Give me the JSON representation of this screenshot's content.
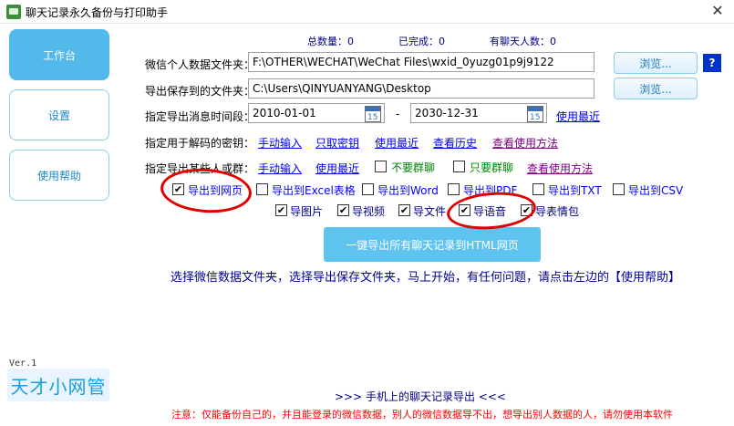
{
  "window": {
    "title": "聊天记录永久备份与打印助手",
    "close_glyph": "✕"
  },
  "nav": {
    "items": [
      {
        "label": "工作台",
        "active": true
      },
      {
        "label": "设置",
        "active": false
      },
      {
        "label": "使用帮助",
        "active": false
      }
    ],
    "version": "Ver.1",
    "logo": "天才小网管"
  },
  "stats": {
    "total": "总数量：0",
    "done": "已完成：0",
    "chat_people": "有聊天人数：0"
  },
  "form": {
    "wechat_folder_label": "微信个人数据文件夹：",
    "wechat_folder_value": "F:\\OTHER\\WECHAT\\WeChat Files\\wxid_0yuzg01p9j9122",
    "export_folder_label": "导出保存到的文件夹：",
    "export_folder_value": "C:\\Users\\QINYUANYANG\\Desktop",
    "browse_label": "浏览...",
    "help_q": "?",
    "time_label": "指定导出消息时间段：",
    "date_start": "2010-01-01",
    "date_sep": "-",
    "date_end": "2030-12-31",
    "cal_num": "15",
    "use_recent": "使用最近",
    "key_label": "指定用于解码的密钥：",
    "key_links": {
      "manual": "手动输入",
      "fetch": "只取密钥",
      "recent": "使用最近",
      "history": "查看历史",
      "method": "查看使用方法"
    },
    "people_label": "指定导出某些人或群：",
    "people_links": {
      "manual": "手动输入",
      "recent": "使用最近",
      "method": "查看使用方法"
    },
    "no_groups": "不要群聊",
    "only_groups": "只要群聊"
  },
  "export_formats": [
    {
      "label": "导出到网页",
      "checked": true
    },
    {
      "label": "导出到Excel表格",
      "checked": false
    },
    {
      "label": "导出到Word",
      "checked": false
    },
    {
      "label": "导出到PDF",
      "checked": false
    },
    {
      "label": "导出到TXT",
      "checked": false
    },
    {
      "label": "导出到CSV",
      "checked": false
    }
  ],
  "export_media": [
    {
      "label": "导图片",
      "checked": true
    },
    {
      "label": "导视频",
      "checked": true
    },
    {
      "label": "导文件",
      "checked": true
    },
    {
      "label": "导语音",
      "checked": true
    },
    {
      "label": "导表情包",
      "checked": true
    }
  ],
  "main_button": "一键导出所有聊天记录到HTML网页",
  "hint": "选择微信数据文件夹，选择导出保存文件夹，马上开始，有任何问题，请点击左边的【使用帮助】",
  "bottom_link": ">>>  手机上的聊天记录导出  <<<",
  "notice": "注意：仅能备份自己的，并且能登录的微信数据，别人的微信数据导不出，想导出别人数据的人，请勿使用本软件"
}
